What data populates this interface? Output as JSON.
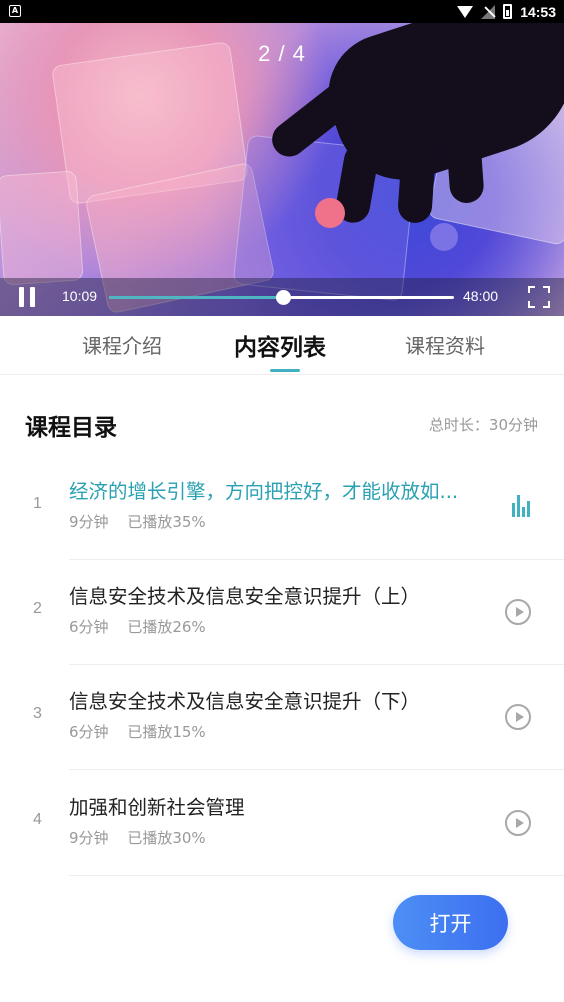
{
  "status_bar": {
    "left_icon": "A",
    "time": "14:53",
    "icons": [
      "wifi-icon",
      "signal-icon",
      "battery-icon"
    ]
  },
  "video": {
    "page_indicator": "2 / 4",
    "current_time": "10:09",
    "total_time": "48:00",
    "progress": 0.505,
    "state": "playing"
  },
  "tabs": [
    {
      "label": "课程介绍",
      "active": false
    },
    {
      "label": "内容列表",
      "active": true
    },
    {
      "label": "课程资料",
      "active": false
    }
  ],
  "catalog": {
    "title": "课程目录",
    "total_duration": "总时长：30分钟",
    "items": [
      {
        "index": "1",
        "title": "经济的增长引擎，方向把控好，才能收放如...",
        "duration": "9分钟",
        "played": "已播放35%",
        "playing": true
      },
      {
        "index": "2",
        "title": "信息安全技术及信息安全意识提升（上）",
        "duration": "6分钟",
        "played": "已播放26%",
        "playing": false
      },
      {
        "index": "3",
        "title": "信息安全技术及信息安全意识提升（下）",
        "duration": "6分钟",
        "played": "已播放15%",
        "playing": false
      },
      {
        "index": "4",
        "title": "加强和创新社会管理",
        "duration": "9分钟",
        "played": "已播放30%",
        "playing": false
      }
    ]
  },
  "open_button": "打开",
  "colors": {
    "accent": "#3fb1c0",
    "active_title": "#2aa1b2",
    "button": "#4082f2"
  }
}
